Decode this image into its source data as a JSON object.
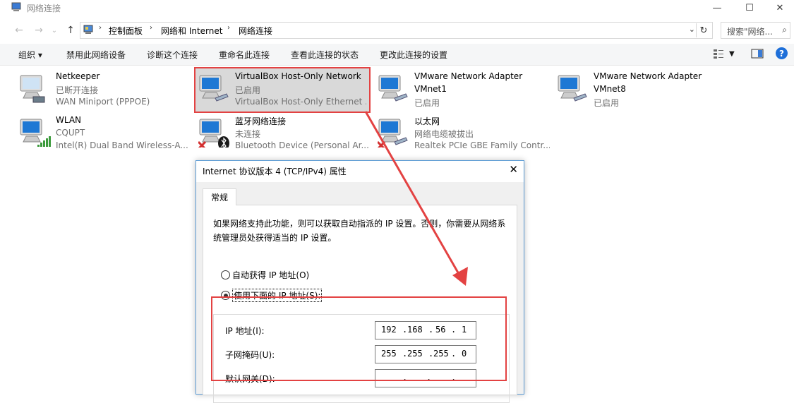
{
  "window": {
    "title": "网络连接",
    "minimize": "—",
    "maximize": "☐",
    "close": "✕"
  },
  "address": {
    "crumbs": [
      "控制面板",
      "网络和 Internet",
      "网络连接"
    ],
    "search_placeholder": "搜索\"网络...",
    "search_icon": "search-icon"
  },
  "toolbar": {
    "organize": "组织 ▾",
    "disable": "禁用此网络设备",
    "diagnose": "诊断这个连接",
    "rename": "重命名此连接",
    "status": "查看此连接的状态",
    "change": "更改此连接的设置",
    "help": "?"
  },
  "connections": [
    {
      "name": "Netkeeper",
      "status": "已断开连接",
      "device": "WAN Miniport (PPPOE)"
    },
    {
      "name": "VirtualBox Host-Only Network",
      "status": "已启用",
      "device": "VirtualBox Host-Only Ethernet ..."
    },
    {
      "name": "VMware Network Adapter",
      "status": "VMnet1",
      "device": "已启用"
    },
    {
      "name": "VMware Network Adapter",
      "status": "VMnet8",
      "device": "已启用"
    },
    {
      "name": "WLAN",
      "status": "CQUPT",
      "device": "Intel(R) Dual Band Wireless-A..."
    },
    {
      "name": "蓝牙网络连接",
      "status": "未连接",
      "device": "Bluetooth Device (Personal Ar..."
    },
    {
      "name": "以太网",
      "status": "网络电缆被拔出",
      "device": "Realtek PCIe GBE Family Contr..."
    }
  ],
  "dialog": {
    "title": "Internet 协议版本 4 (TCP/IPv4) 属性",
    "close": "✕",
    "tab": "常规",
    "description": "如果网络支持此功能，则可以获取自动指派的 IP 设置。否则，你需要从网络系统管理员处获得适当的 IP 设置。",
    "radio_auto": "自动获得 IP 地址(O)",
    "radio_manual": "使用下面的 IP 地址(S):",
    "selected_option": "manual",
    "ip_label": "IP 地址(I):",
    "subnet_label": "子网掩码(U):",
    "gateway_label": "默认网关(D):",
    "ip": [
      "192",
      "168",
      "56",
      "1"
    ],
    "subnet": [
      "255",
      "255",
      "255",
      "0"
    ],
    "gateway": [
      "",
      "",
      "",
      ""
    ]
  },
  "colors": {
    "highlight": "#e34242",
    "selection_bg": "#d9d9d9",
    "toolbar_bg": "#f5f6f7"
  }
}
